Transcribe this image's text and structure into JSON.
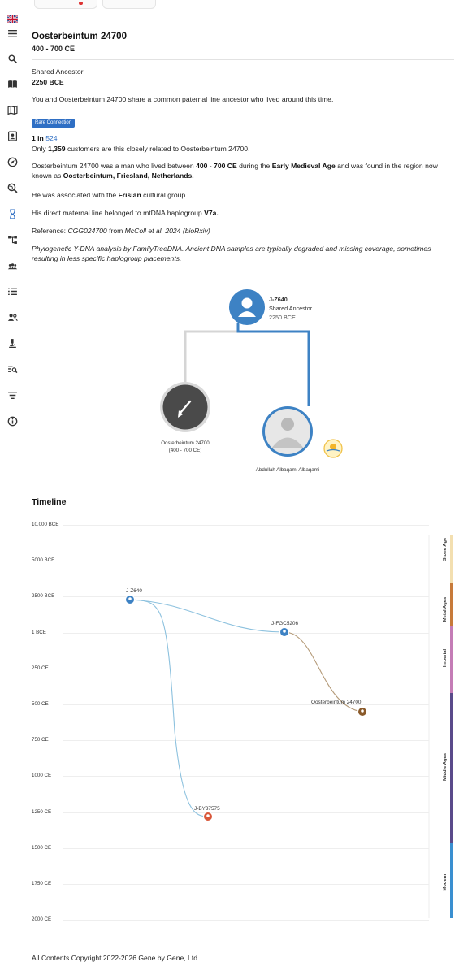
{
  "flag": "UK",
  "sidebar_icons": [
    "menu-icon",
    "search-icon",
    "book-icon",
    "map-icon",
    "portrait-icon",
    "compass-icon",
    "search-globe-icon",
    "hourglass-icon",
    "tree-icon",
    "group-icon",
    "list-icon",
    "people-icon",
    "microscope-icon",
    "search-list-icon",
    "filter-list-icon",
    "info-icon"
  ],
  "header": {
    "title": "Oosterbeintum 24700",
    "subtitle": "400 - 700 CE"
  },
  "shared_ancestor": {
    "label": "Shared Ancestor",
    "date": "2250 BCE",
    "description": "You and Oosterbeintum 24700 share a common paternal line ancestor who lived around this time."
  },
  "badge": "Rare Connection",
  "rarity": {
    "prefix": "1 in ",
    "value": "524",
    "line_pre": "Only ",
    "count": "1,359",
    "line_post": " customers are this closely related to Oosterbeintum 24700."
  },
  "bio": {
    "p1_a": "Oosterbeintum 24700 was a man who lived between ",
    "p1_b": "400 - 700 CE",
    "p1_c": " during the ",
    "p1_d": "Early Medieval Age",
    "p1_e": " and was found in the region now known as ",
    "p1_f": "Oosterbeintum, Friesland, Netherlands.",
    "p2_a": "He was associated with the ",
    "p2_b": "Frisian",
    "p2_c": " cultural group.",
    "p3_a": "His direct maternal line belonged to mtDNA haplogroup ",
    "p3_b": "V7a.",
    "p4_a": "Reference: ",
    "p4_b": "CGG024700",
    "p4_c": " from ",
    "p4_d": "McColl et al. 2024 (bioRxiv)",
    "p5": "Phylogenetic Y-DNA analysis by FamilyTreeDNA. Ancient DNA samples are typically degraded and missing coverage, sometimes resulting in less specific haplogroup placements."
  },
  "tree": {
    "ancestor_haplogroup": "J-Z640",
    "ancestor_label": "Shared Ancestor",
    "ancestor_date": "2250 BCE",
    "left_name": "Oosterbeintum 24700",
    "left_date": "(400 - 700 CE)",
    "right_name": "Abdullah Albaqami Albaqami"
  },
  "timeline": {
    "title": "Timeline",
    "y_ticks": [
      "10,000 BCE",
      "5000 BCE",
      "2500 BCE",
      "1 BCE",
      "250 CE",
      "500 CE",
      "750 CE",
      "1000 CE",
      "1250 CE",
      "1500 CE",
      "1750 CE",
      "2000 CE"
    ],
    "nodes": [
      {
        "label": "J-Z640",
        "date": "2500 BCE"
      },
      {
        "label": "J-FGC5206",
        "date": "1 BCE"
      },
      {
        "label": "Oosterbeintum 24700",
        "date": "550 CE"
      },
      {
        "label": "J-BY37575",
        "date": "1300 CE"
      }
    ],
    "eras": [
      "Stone Age",
      "Metal Ages",
      "Imperial",
      "Middle Ages",
      "Modern"
    ],
    "colors": {
      "stone": "#f3dfb0",
      "metal": "#c77a3a",
      "imperial": "#c47cb6",
      "middle": "#5a4a8a",
      "modern": "#3a8fd0",
      "line_blue": "#8cc1de",
      "line_brown": "#b49a78",
      "node_blue": "#3d82c4",
      "node_orange": "#d8573a",
      "node_brown": "#8a5a2a"
    }
  },
  "footer": "All Contents Copyright 2022-2026 Gene by Gene, Ltd."
}
